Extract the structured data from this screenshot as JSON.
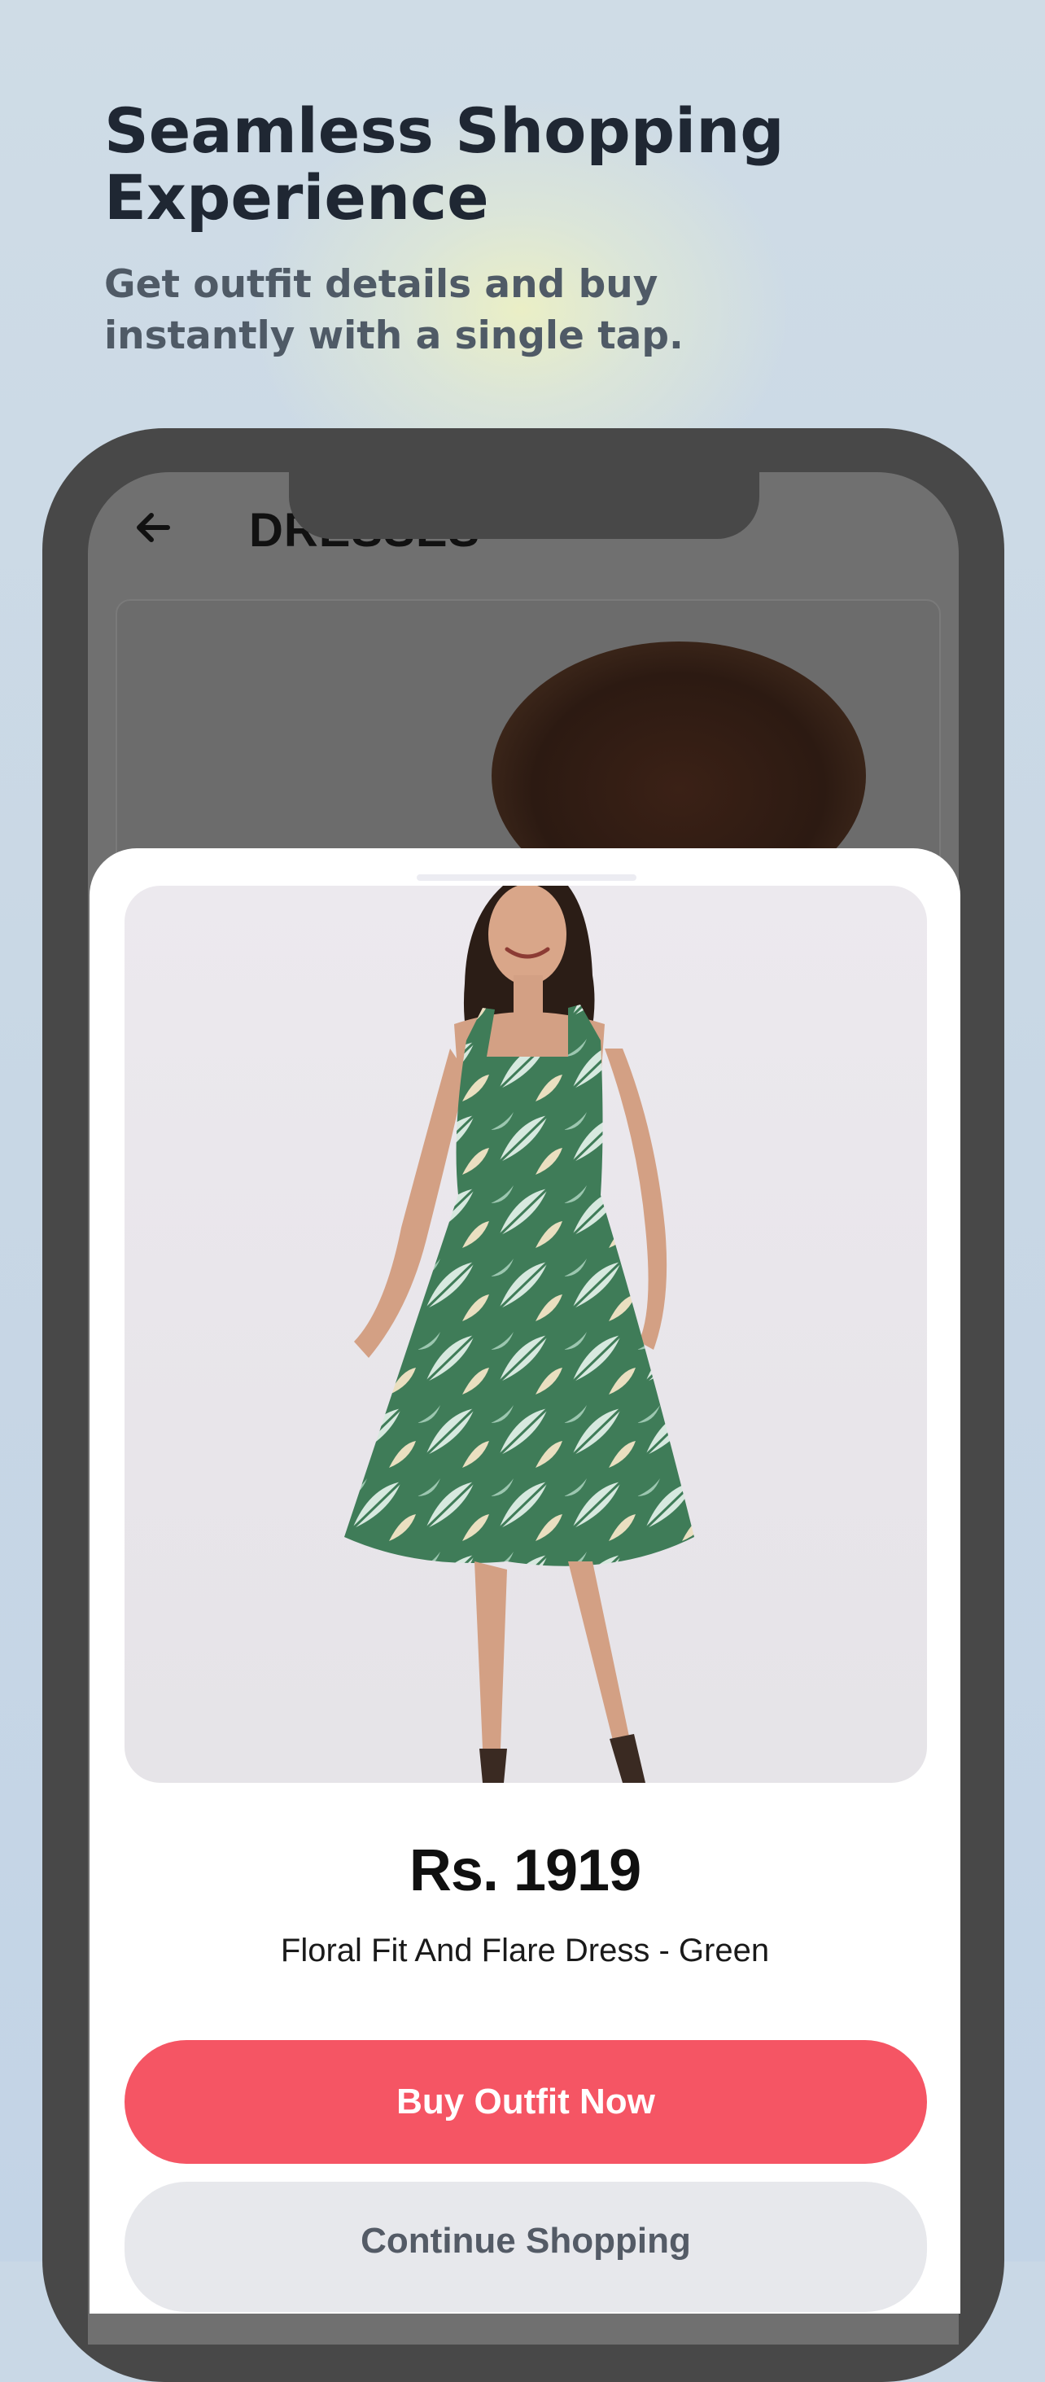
{
  "promo": {
    "headline": "Seamless Shopping Experience",
    "subhead": "Get outfit details and buy instantly with a single tap."
  },
  "app_header": {
    "back_icon": "arrow-left-icon",
    "title": "DRESSES"
  },
  "product": {
    "image": "woman-in-green-floral-dress",
    "price": "Rs. 1919",
    "name": "Floral Fit And Flare Dress - Green"
  },
  "actions": {
    "buy_label": "Buy Outfit Now",
    "continue_label": "Continue Shopping"
  },
  "colors": {
    "accent": "#f55564",
    "secondary_button": "#e7e8ec",
    "phone_frame": "#484848"
  }
}
